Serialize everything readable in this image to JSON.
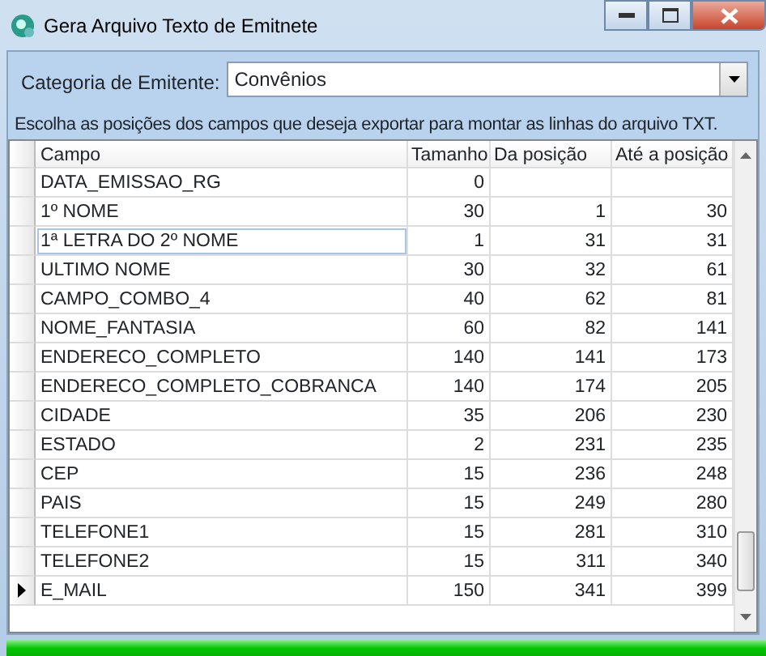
{
  "window": {
    "title": "Gera Arquivo Texto de Emitnete"
  },
  "category": {
    "label": "Categoria de Emitente:",
    "value": "Convênios"
  },
  "instruction": "Escolha as posições dos campos que deseja exportar para montar as linhas do arquivo TXT.",
  "table": {
    "columns": [
      "Campo",
      "Tamanho",
      "Da posição",
      "Até a posição"
    ],
    "rows": [
      {
        "cells": [
          "DATA_EMISSAO_RG",
          "0",
          "",
          ""
        ],
        "selected": false,
        "focused": false
      },
      {
        "cells": [
          "1º NOME",
          "30",
          "1",
          "30"
        ],
        "selected": false,
        "focused": false
      },
      {
        "cells": [
          "1ª LETRA DO 2º NOME",
          "1",
          "31",
          "31"
        ],
        "selected": false,
        "focused": true
      },
      {
        "cells": [
          "ULTIMO NOME",
          "30",
          "32",
          "61"
        ],
        "selected": false,
        "focused": false
      },
      {
        "cells": [
          "CAMPO_COMBO_4",
          "40",
          "62",
          "81"
        ],
        "selected": false,
        "focused": false
      },
      {
        "cells": [
          "NOME_FANTASIA",
          "60",
          "82",
          "141"
        ],
        "selected": false,
        "focused": false
      },
      {
        "cells": [
          "ENDERECO_COMPLETO",
          "140",
          "141",
          "173"
        ],
        "selected": false,
        "focused": false
      },
      {
        "cells": [
          "ENDERECO_COMPLETO_COBRANCA",
          "140",
          "174",
          "205"
        ],
        "selected": false,
        "focused": false
      },
      {
        "cells": [
          "CIDADE",
          "35",
          "206",
          "230"
        ],
        "selected": false,
        "focused": false
      },
      {
        "cells": [
          "ESTADO",
          "2",
          "231",
          "235"
        ],
        "selected": false,
        "focused": false
      },
      {
        "cells": [
          "CEP",
          "15",
          "236",
          "248"
        ],
        "selected": false,
        "focused": false
      },
      {
        "cells": [
          "PAIS",
          "15",
          "249",
          "280"
        ],
        "selected": false,
        "focused": false
      },
      {
        "cells": [
          "TELEFONE1",
          "15",
          "281",
          "310"
        ],
        "selected": false,
        "focused": false
      },
      {
        "cells": [
          "TELEFONE2",
          "15",
          "311",
          "340"
        ],
        "selected": false,
        "focused": false
      },
      {
        "cells": [
          "E_MAIL",
          "150",
          "341",
          "399"
        ],
        "selected": true,
        "focused": false
      }
    ]
  },
  "progress": {
    "level": 1
  }
}
